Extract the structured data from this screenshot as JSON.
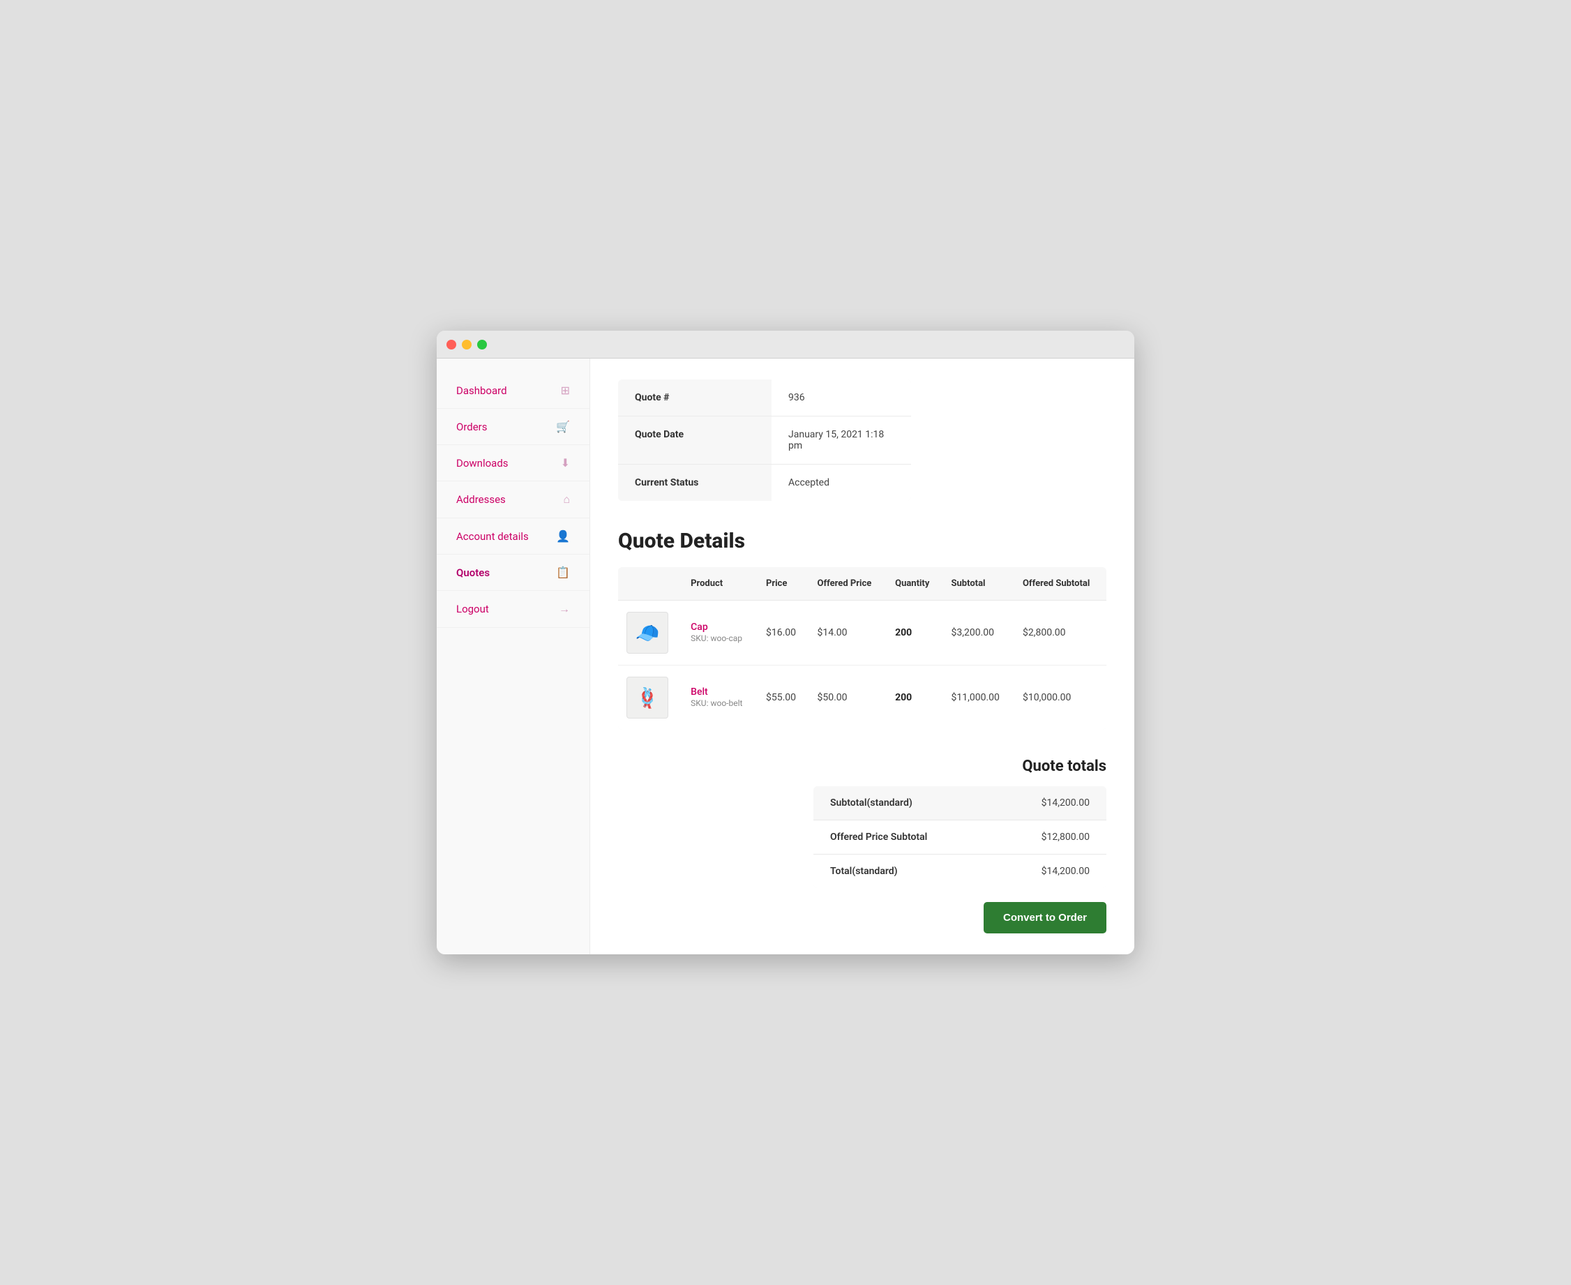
{
  "window": {
    "title": "Quote Details"
  },
  "sidebar": {
    "items": [
      {
        "id": "dashboard",
        "label": "Dashboard",
        "icon": "🏠",
        "active": false
      },
      {
        "id": "orders",
        "label": "Orders",
        "icon": "🛒",
        "active": false
      },
      {
        "id": "downloads",
        "label": "Downloads",
        "icon": "📄",
        "active": false
      },
      {
        "id": "addresses",
        "label": "Addresses",
        "icon": "🏡",
        "active": false
      },
      {
        "id": "account-details",
        "label": "Account details",
        "icon": "👤",
        "active": false
      },
      {
        "id": "quotes",
        "label": "Quotes",
        "icon": "📋",
        "active": true
      },
      {
        "id": "logout",
        "label": "Logout",
        "icon": "➡️",
        "active": false
      }
    ]
  },
  "quote_info": {
    "rows": [
      {
        "label": "Quote #",
        "value": "936"
      },
      {
        "label": "Quote Date",
        "value": "January 15, 2021 1:18 pm"
      },
      {
        "label": "Current Status",
        "value": "Accepted"
      }
    ]
  },
  "quote_details": {
    "section_title": "Quote Details",
    "columns": [
      "Product",
      "Price",
      "Offered Price",
      "Quantity",
      "Subtotal",
      "Offered Subtotal"
    ],
    "rows": [
      {
        "id": "cap",
        "product_name": "Cap",
        "sku": "SKU: woo-cap",
        "emoji": "🧢",
        "price": "$16.00",
        "offered_price": "$14.00",
        "quantity": "200",
        "subtotal": "$3,200.00",
        "offered_subtotal": "$2,800.00"
      },
      {
        "id": "belt",
        "product_name": "Belt",
        "sku": "SKU: woo-belt",
        "emoji": "🪢",
        "price": "$55.00",
        "offered_price": "$50.00",
        "quantity": "200",
        "subtotal": "$11,000.00",
        "offered_subtotal": "$10,000.00"
      }
    ]
  },
  "quote_totals": {
    "title": "Quote totals",
    "rows": [
      {
        "label": "Subtotal(standard)",
        "value": "$14,200.00"
      },
      {
        "label": "Offered Price Subtotal",
        "value": "$12,800.00"
      },
      {
        "label": "Total(standard)",
        "value": "$14,200.00"
      }
    ],
    "convert_button": "Convert to Order"
  }
}
